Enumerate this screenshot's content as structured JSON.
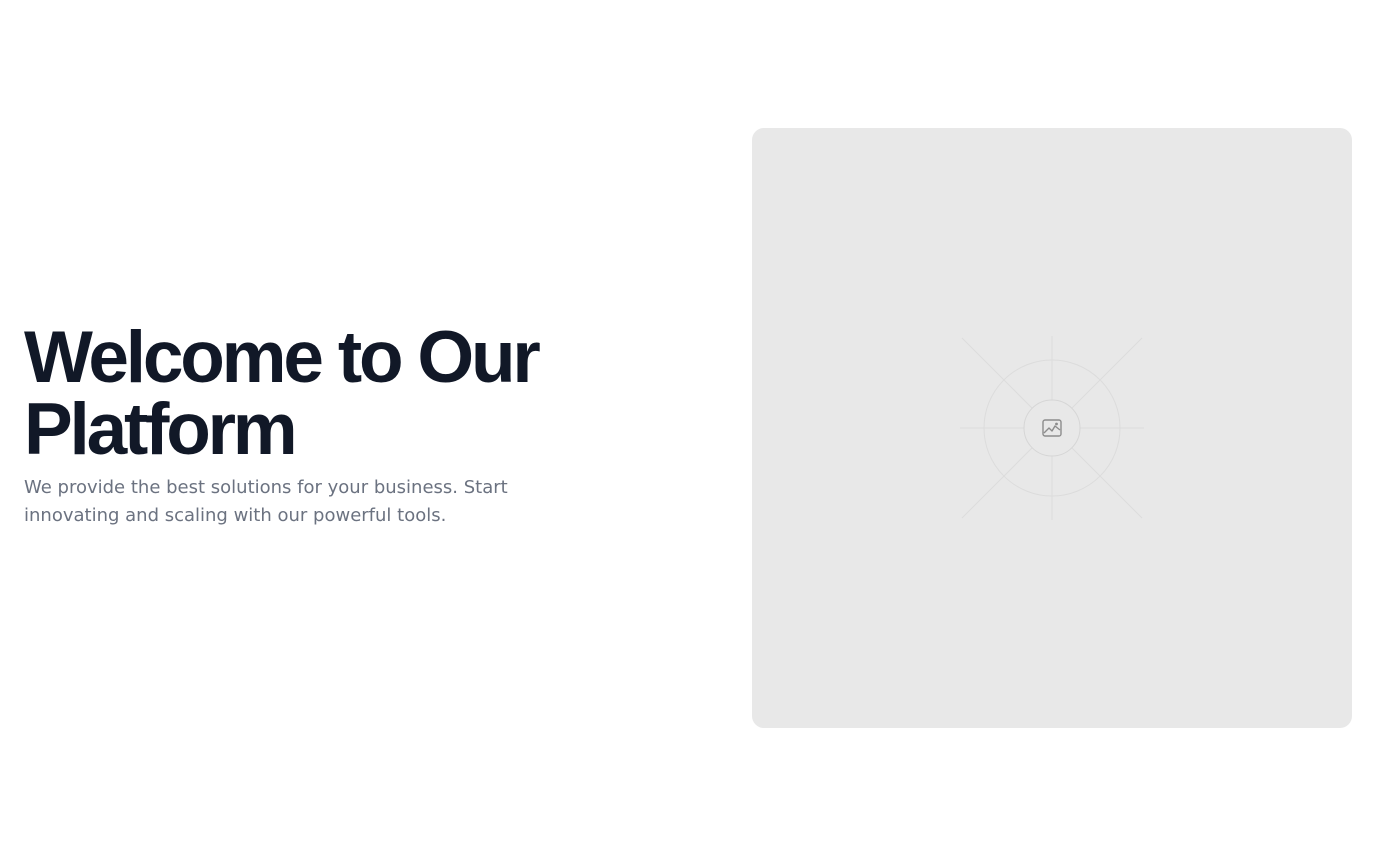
{
  "hero": {
    "title_line1": "Welcome to Our",
    "title_line2": "Platform",
    "subtitle": "We provide the best solutions for your business. Start innovating and scaling with our powerful tools."
  },
  "media": {
    "icon": "image-icon",
    "background_color": "#e8e8e8"
  },
  "colors": {
    "title": "#111827",
    "subtitle": "#6b7280",
    "page_background": "#ffffff"
  }
}
